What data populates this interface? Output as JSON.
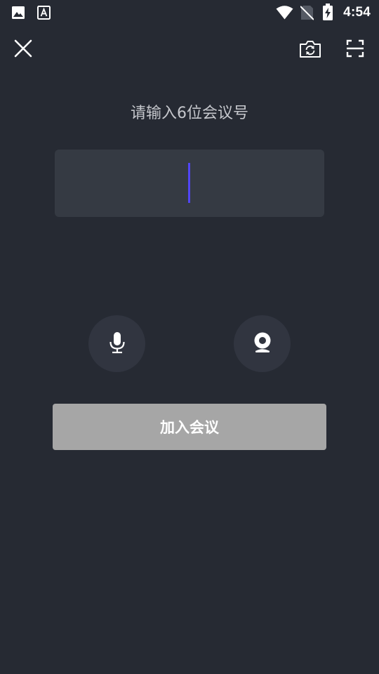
{
  "status_bar": {
    "time": "4:54",
    "left_icons": [
      "gallery-notification-icon",
      "text-notification-icon"
    ],
    "right_icons": [
      "wifi-icon",
      "no-sim-icon",
      "battery-charging-icon"
    ]
  },
  "toolbar": {
    "close_icon": "close-icon",
    "switch_camera_icon": "camera-switch-icon",
    "scan_icon": "scan-icon"
  },
  "prompt": {
    "text": "请输入6位会议号"
  },
  "meeting_code_input": {
    "value": "",
    "placeholder": ""
  },
  "controls": {
    "microphone_icon": "microphone-icon",
    "camera_icon": "webcam-icon"
  },
  "join_button": {
    "label": "加入会议"
  },
  "colors": {
    "background": "#262a33",
    "input_background": "#353a43",
    "round_button_background": "#313540",
    "caret": "#5145f5",
    "join_button_disabled": "#a6a6a6",
    "prompt_text": "#c5c7cc"
  }
}
